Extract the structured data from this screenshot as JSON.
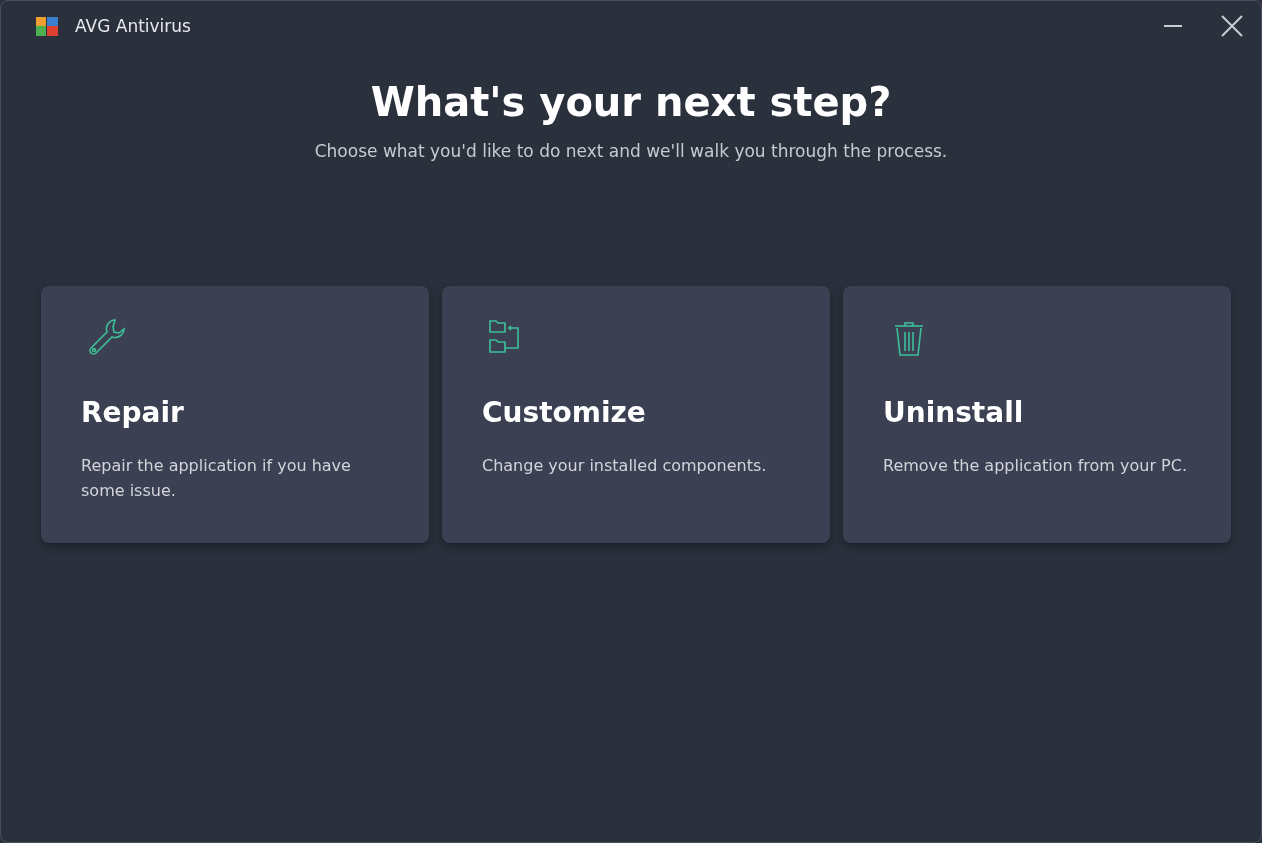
{
  "window": {
    "title": "AVG Antivirus"
  },
  "heading": "What's your next step?",
  "subtitle": "Choose what you'd like to do next and we'll walk you through the process.",
  "options": [
    {
      "kind": "repair",
      "title": "Repair",
      "description": "Repair the application if you have some issue."
    },
    {
      "kind": "customize",
      "title": "Customize",
      "description": "Change your installed components."
    },
    {
      "kind": "uninstall",
      "title": "Uninstall",
      "description": "Remove the application from your PC."
    }
  ]
}
